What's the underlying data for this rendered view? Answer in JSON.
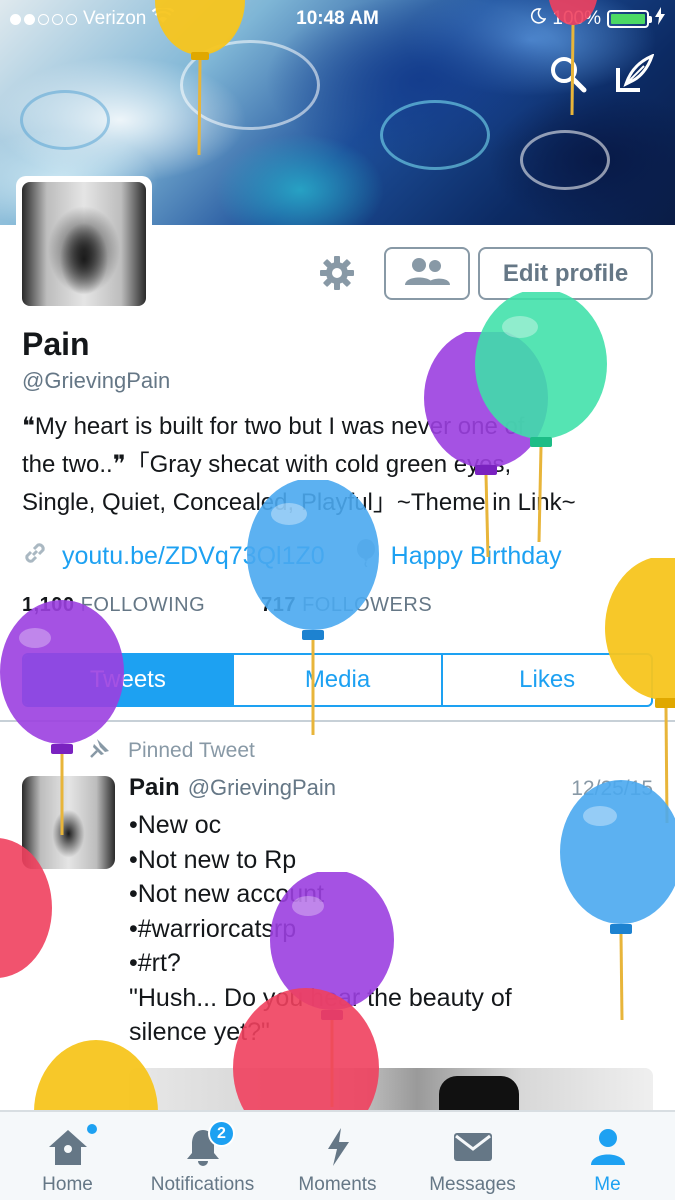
{
  "status_bar": {
    "carrier": "Verizon",
    "time": "10:48 AM",
    "battery": "100%",
    "signal_bars_filled": 2,
    "signal_bars_total": 5
  },
  "header": {
    "icons": [
      "search-icon",
      "compose-tweet-icon"
    ]
  },
  "profile": {
    "name": "Pain",
    "handle": "@GrievingPain",
    "edit_button": "Edit profile",
    "bio_lines": [
      "❝My heart is built for two but I was never one of",
      "the two..❞「Gray shecat with cold green eyes,",
      "Single, Quiet, Concealed, Playful」~Theme in Link~"
    ],
    "link": "youtu.be/ZDVq73Ql1Z0",
    "birthday": "Happy Birthday",
    "following_count": "1,100",
    "following_label": "FOLLOWING",
    "followers_count": "717",
    "followers_label": "FOLLOWERS"
  },
  "tabs": [
    {
      "label": "Tweets",
      "active": true
    },
    {
      "label": "Media",
      "active": false
    },
    {
      "label": "Likes",
      "active": false
    }
  ],
  "pinned_tweet": {
    "pinned_label": "Pinned Tweet",
    "author_name": "Pain",
    "author_handle": "@GrievingPain",
    "date": "12/25/15",
    "lines": [
      "•New oc",
      "•Not new to Rp",
      "•Not new account",
      "•#warriorcatsrp",
      "•#rt?",
      "\"Hush... Do you hear the beauty of",
      "silence yet?\""
    ]
  },
  "bottom_nav": [
    {
      "label": "Home",
      "icon": "home-icon"
    },
    {
      "label": "Notifications",
      "icon": "bell-icon",
      "badge": "2"
    },
    {
      "label": "Moments",
      "icon": "lightning-icon"
    },
    {
      "label": "Messages",
      "icon": "envelope-icon"
    },
    {
      "label": "Me",
      "icon": "person-icon",
      "active": true
    }
  ],
  "colors": {
    "accent": "#1da1f2",
    "text": "#14171a",
    "muted": "#657786",
    "balloon_yellow": "#f7c51e",
    "balloon_purple": "#9b3fe0",
    "balloon_green": "#3ee0a8",
    "balloon_blue": "#4aa8f0",
    "balloon_red": "#f0405e"
  }
}
